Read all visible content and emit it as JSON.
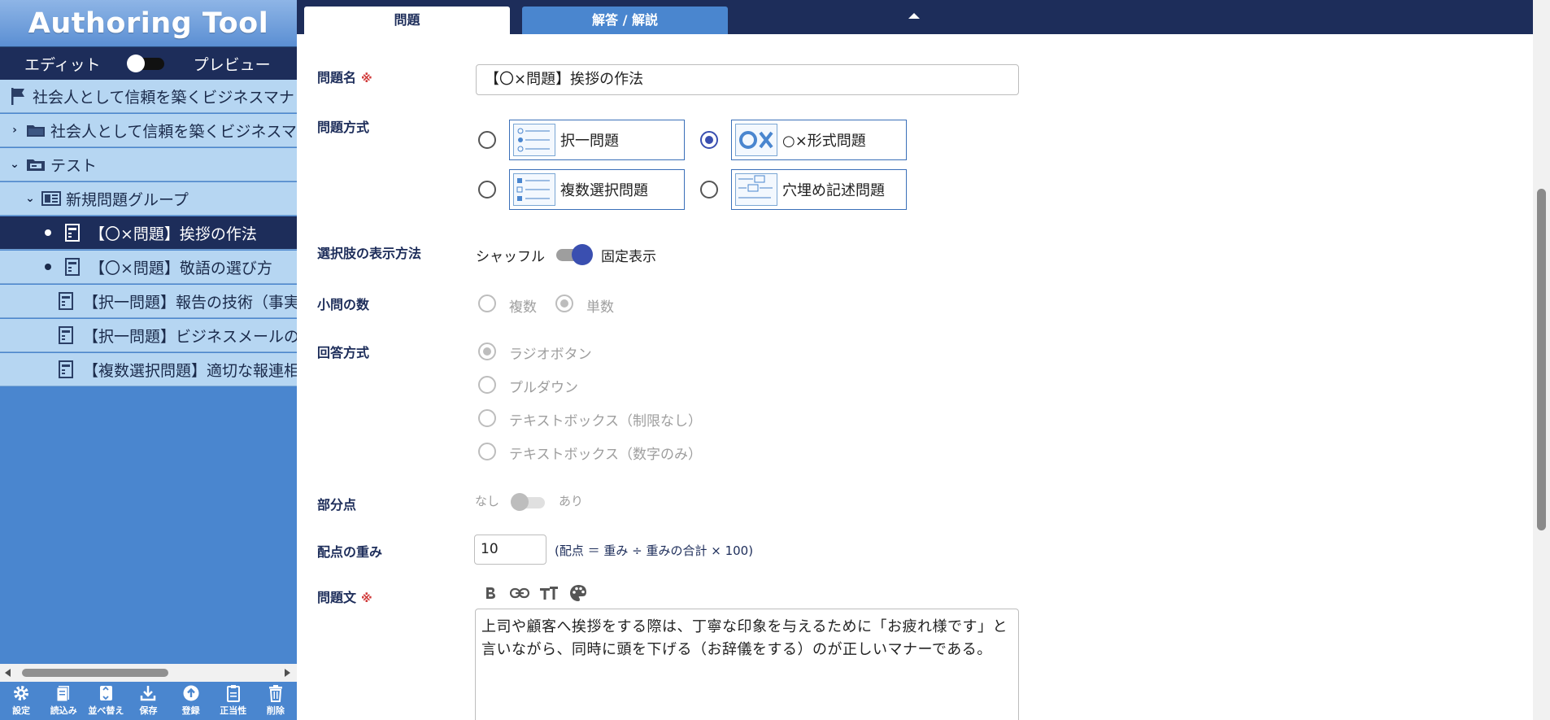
{
  "app": {
    "title": "Authoring Tool"
  },
  "mode": {
    "edit_label": "エディット",
    "preview_label": "プレビュー"
  },
  "tree": {
    "items": [
      {
        "label": "社会人として信頼を築くビジネスマナ"
      },
      {
        "label": "社会人として信頼を築くビジネスマ"
      },
      {
        "label": "テスト"
      },
      {
        "label": "新規問題グループ"
      },
      {
        "label": "【〇×問題】挨拶の作法"
      },
      {
        "label": "【〇×問題】敬語の選び方"
      },
      {
        "label": "【択一問題】報告の技術（事実"
      },
      {
        "label": "【択一問題】ビジネスメールの"
      },
      {
        "label": "【複数選択問題】適切な報連相"
      }
    ]
  },
  "toolbar": {
    "settings": "設定",
    "load": "読込み",
    "sort": "並べ替え",
    "save": "保存",
    "register": "登録",
    "validity": "正当性",
    "delete": "削除"
  },
  "tabs": {
    "question": "問題",
    "answer": "解答 / 解説"
  },
  "form": {
    "title_label": "問題名",
    "required_mark": "※",
    "title_value": "【〇×問題】挨拶の作法",
    "type_label": "問題方式",
    "types": [
      "択一問題",
      "○×形式問題",
      "複数選択問題",
      "穴埋め記述問題"
    ],
    "type_selected": "○×形式問題",
    "display_label": "選択肢の表示方法",
    "shuffle_label": "シャッフル",
    "fixed_label": "固定表示",
    "subq_label": "小問の数",
    "subq_multi": "複数",
    "subq_single": "単数",
    "answer_label": "回答方式",
    "answer_options": [
      "ラジオボタン",
      "プルダウン",
      "テキストボックス（制限なし）",
      "テキストボックス（数字のみ）"
    ],
    "partial_label": "部分点",
    "partial_off": "なし",
    "partial_on": "あり",
    "weight_label": "配点の重み",
    "weight_value": "10",
    "weight_note": "(配点 ＝ 重み ÷ 重みの合計 × 100)",
    "body_label": "問題文",
    "body_text": "上司や顧客へ挨拶をする際は、丁寧な印象を与えるために「お疲れ様です」と言いながら、同時に頭を下げる（お辞儀をする）のが正しいマナーである。"
  },
  "colors": {
    "navy": "#1d2d5a",
    "sidebar_blue": "#4a86cf",
    "tree_bg": "#b6d6f2",
    "accent": "#3a4fb0",
    "required": "#d03a3a"
  }
}
